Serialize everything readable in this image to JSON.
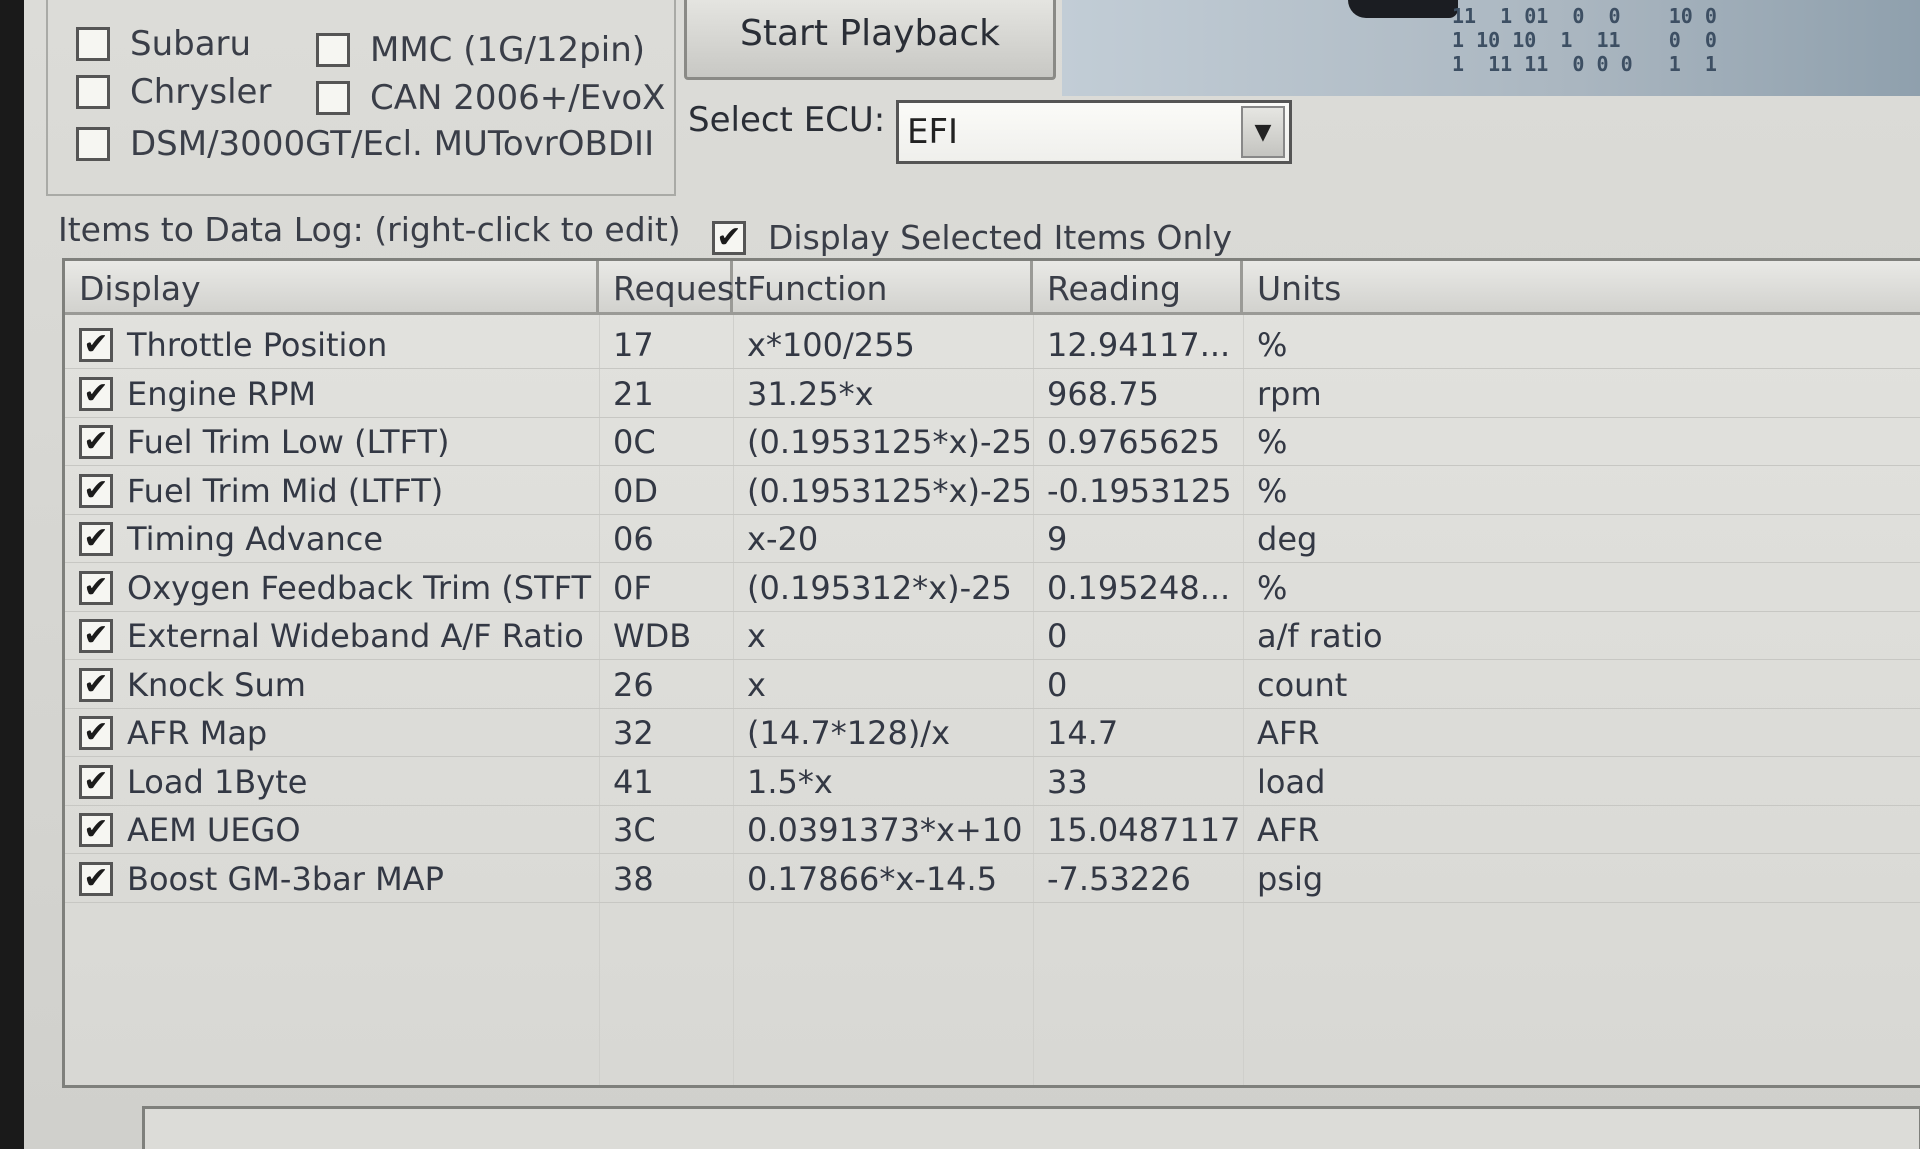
{
  "protocols": {
    "left": [
      {
        "label": "Subaru",
        "checked": false
      },
      {
        "label": "Chrysler",
        "checked": false
      },
      {
        "label": "DSM/3000GT/Ecl. MUTovrOBDII",
        "checked": false
      }
    ],
    "right": [
      {
        "label": "MMC (1G/12pin)",
        "checked": false
      },
      {
        "label": "CAN 2006+/EvoX",
        "checked": false
      }
    ]
  },
  "playback": {
    "start_label": "Start Playback"
  },
  "ecu": {
    "label": "Select ECU:",
    "value": "EFI"
  },
  "banner": {
    "bits": "11  1 01  0  0    10 0\n1 10 10  1  11    0  0\n1  11 11  0 0 0   1  1"
  },
  "items": {
    "label": "Items to Data Log: (right-click to edit)",
    "display_selected_label": "Display Selected Items Only",
    "display_selected_checked": true
  },
  "table": {
    "headers": {
      "display": "Display",
      "request": "Request",
      "function": "Function",
      "reading": "Reading",
      "units": "Units"
    },
    "rows": [
      {
        "checked": true,
        "display": "Throttle Position",
        "request": "17",
        "function": "x*100/255",
        "reading": "12.94117...",
        "units": "%"
      },
      {
        "checked": true,
        "display": "Engine RPM",
        "request": "21",
        "function": "31.25*x",
        "reading": "968.75",
        "units": "rpm"
      },
      {
        "checked": true,
        "display": "Fuel Trim Low (LTFT)",
        "request": "0C",
        "function": "(0.1953125*x)-25",
        "reading": "0.9765625",
        "units": "%"
      },
      {
        "checked": true,
        "display": "Fuel Trim Mid (LTFT)",
        "request": "0D",
        "function": "(0.1953125*x)-25",
        "reading": "-0.1953125",
        "units": "%"
      },
      {
        "checked": true,
        "display": "Timing Advance",
        "request": "06",
        "function": "x-20",
        "reading": "9",
        "units": "deg"
      },
      {
        "checked": true,
        "display": "Oxygen Feedback Trim (STFT)",
        "request": "0F",
        "function": "(0.195312*x)-25",
        "reading": "0.195248...",
        "units": "%"
      },
      {
        "checked": true,
        "display": "External Wideband A/F Ratio",
        "request": "WDB",
        "function": "x",
        "reading": "0",
        "units": "a/f ratio"
      },
      {
        "checked": true,
        "display": "Knock Sum",
        "request": "26",
        "function": "x",
        "reading": "0",
        "units": "count"
      },
      {
        "checked": true,
        "display": "AFR Map",
        "request": "32",
        "function": "(14.7*128)/x",
        "reading": "14.7",
        "units": "AFR"
      },
      {
        "checked": true,
        "display": "Load 1Byte",
        "request": "41",
        "function": "1.5*x",
        "reading": "33",
        "units": "load"
      },
      {
        "checked": true,
        "display": "AEM UEGO",
        "request": "3C",
        "function": "0.0391373*x+10",
        "reading": "15.0487117",
        "units": "AFR"
      },
      {
        "checked": true,
        "display": "Boost GM-3bar MAP",
        "request": "38",
        "function": "0.17866*x-14.5",
        "reading": "-7.53226",
        "units": "psig"
      }
    ]
  }
}
